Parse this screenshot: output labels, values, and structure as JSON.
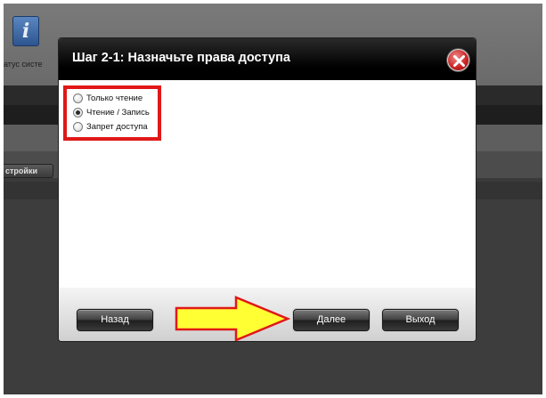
{
  "background": {
    "status_label": "атус систе",
    "settings_tab": "стройки",
    "info_icon_glyph": "i"
  },
  "dialog": {
    "title": "Шаг 2-1: Назначьте права доступа",
    "close_glyph": "close-icon",
    "options": [
      {
        "label": "Только чтение",
        "checked": false
      },
      {
        "label": "Чтение / Запись",
        "checked": true
      },
      {
        "label": "Запрет доступа",
        "checked": false
      }
    ],
    "buttons": {
      "back": "Назад",
      "next": "Далее",
      "exit": "Выход"
    }
  },
  "colors": {
    "highlight": "#e01818",
    "arrow_fill": "#ffff33",
    "arrow_stroke": "#e01818",
    "close_red": "#c82020"
  }
}
